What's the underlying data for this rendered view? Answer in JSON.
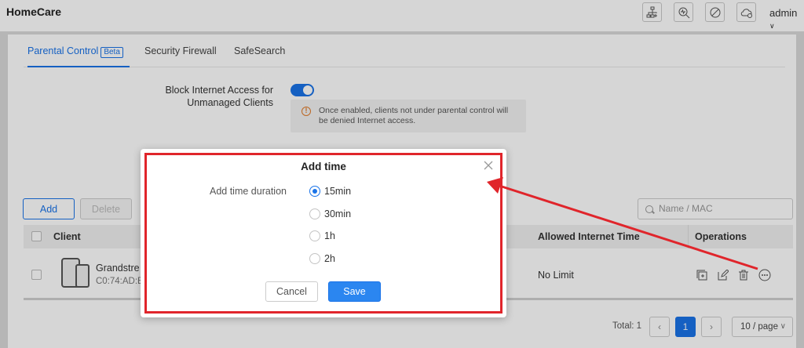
{
  "app": {
    "title": "HomeCare",
    "user": "admin"
  },
  "header_icons": [
    "network-topology-icon",
    "diagnostics-icon",
    "block-icon",
    "cloud-icon"
  ],
  "tabs": [
    {
      "label": "Parental Control",
      "badge": "Beta",
      "active": true
    },
    {
      "label": "Security Firewall",
      "active": false
    },
    {
      "label": "SafeSearch",
      "active": false
    }
  ],
  "block_access": {
    "label_line1": "Block Internet Access for",
    "label_line2": "Unmanaged Clients",
    "enabled": true,
    "notice_line1": "Once enabled, clients not under parental control will",
    "notice_line2": "be denied Internet access."
  },
  "toolbar": {
    "add_label": "Add",
    "delete_label": "Delete",
    "search_placeholder": "Name / MAC"
  },
  "table": {
    "columns": [
      "Client",
      "Allowed Internet Time",
      "Operations"
    ],
    "rows": [
      {
        "client_name": "Grandstre",
        "client_mac": "C0:74:AD:E",
        "allowed_time": "No Limit"
      }
    ]
  },
  "pagination": {
    "total": "Total: 1",
    "current_page": "1",
    "per_page": "10 / page"
  },
  "modal": {
    "title": "Add time",
    "field_label": "Add time duration",
    "options": [
      "15min",
      "30min",
      "1h",
      "2h"
    ],
    "selected": "15min",
    "cancel_label": "Cancel",
    "save_label": "Save"
  },
  "colors": {
    "accent": "#1a73e8",
    "highlight": "#e0252b",
    "warning": "#e07b2a"
  }
}
